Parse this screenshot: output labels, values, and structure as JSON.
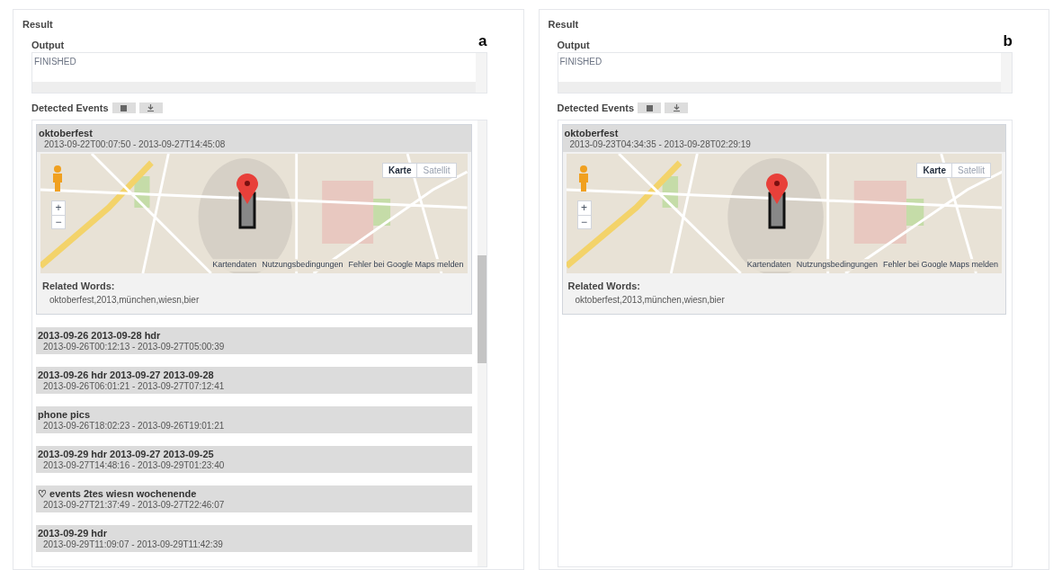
{
  "panels": [
    {
      "label": "a",
      "title": "Result",
      "output_label": "Output",
      "output_value": "FINISHED",
      "events_label": "Detected Events",
      "scrollbar": true,
      "events": [
        {
          "title": "oktoberfest",
          "time": "2013-09-22T00:07:50 - 2013-09-27T14:45:08",
          "expanded": true,
          "map": {
            "map_types": [
              {
                "label": "Karte",
                "selected": true
              },
              {
                "label": "Satellit",
                "selected": false
              }
            ],
            "zoom_in": "+",
            "zoom_out": "−",
            "footer": [
              "Kartendaten",
              "Nutzungsbedingungen",
              "Fehler bei Google Maps melden"
            ]
          },
          "related_label": "Related Words:",
          "related_words": "oktoberfest,2013,münchen,wiesn,bier"
        },
        {
          "title": "2013-09-26 2013-09-28 hdr",
          "time": "2013-09-26T00:12:13 - 2013-09-27T05:00:39",
          "expanded": false
        },
        {
          "title": "2013-09-26 hdr 2013-09-27 2013-09-28",
          "time": "2013-09-26T06:01:21 - 2013-09-27T07:12:41",
          "expanded": false
        },
        {
          "title": "phone pics",
          "time": "2013-09-26T18:02:23 - 2013-09-26T19:01:21",
          "expanded": false
        },
        {
          "title": "2013-09-29 hdr 2013-09-27 2013-09-25",
          "time": "2013-09-27T14:48:16 - 2013-09-29T01:23:40",
          "expanded": false
        },
        {
          "title": "♡ events 2tes wiesn wochenende",
          "time": "2013-09-27T21:37:49 - 2013-09-27T22:46:07",
          "expanded": false
        },
        {
          "title": "2013-09-29 hdr",
          "time": "2013-09-29T11:09:07 - 2013-09-29T11:42:39",
          "expanded": false
        }
      ]
    },
    {
      "label": "b",
      "title": "Result",
      "output_label": "Output",
      "output_value": "FINISHED",
      "events_label": "Detected Events",
      "scrollbar": false,
      "events": [
        {
          "title": "oktoberfest",
          "time": "2013-09-23T04:34:35 - 2013-09-28T02:29:19",
          "expanded": true,
          "map": {
            "map_types": [
              {
                "label": "Karte",
                "selected": true
              },
              {
                "label": "Satellit",
                "selected": false
              }
            ],
            "zoom_in": "+",
            "zoom_out": "−",
            "footer": [
              "Kartendaten",
              "Nutzungsbedingungen",
              "Fehler bei Google Maps melden"
            ]
          },
          "related_label": "Related Words:",
          "related_words": "oktoberfest,2013,münchen,wiesn,bier"
        }
      ]
    }
  ]
}
